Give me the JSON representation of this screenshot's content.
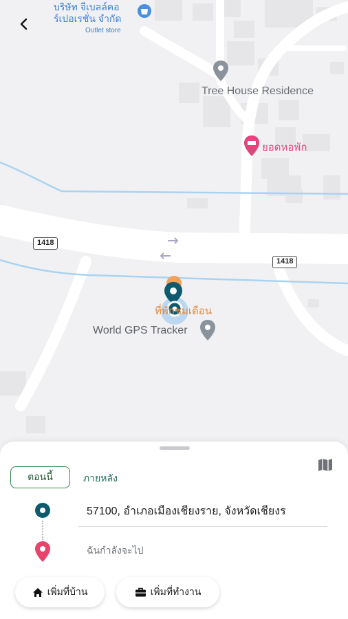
{
  "map": {
    "poi_shop_name": "บริษัท จีเบลล์คอ\nร์เปอเรชั่น จำกัด",
    "poi_shop_sub": "Outlet store",
    "poi_tree": "Tree House Residence",
    "poi_hostel": "ยอดหอพัก",
    "poi_orange": "ที่พักชมเดือน",
    "poi_world": "World GPS Tracker",
    "road_shield_1": "1418",
    "road_shield_2": "1418"
  },
  "sheet": {
    "tab_now": "ตอนนี้",
    "tab_later": "ภายหลัง",
    "origin": "57100, อำเภอเมืองเชียงราย, จังหวัดเชียงร",
    "destination_placeholder": "ฉันกำลังจะไป",
    "add_home": "เพิ่มที่บ้าน",
    "add_work": "เพิ่มที่ทำงาน"
  },
  "colors": {
    "accent": "#0e5a6e",
    "destination_pin": "#e8436a",
    "tab_border": "#2e8a4f",
    "hostel_pin": "#e0457b",
    "shop_pin": "#4a8fe0"
  },
  "icons": {
    "back": "chevron-left-icon",
    "map": "map-icon",
    "home": "home-icon",
    "work": "briefcase-icon"
  }
}
